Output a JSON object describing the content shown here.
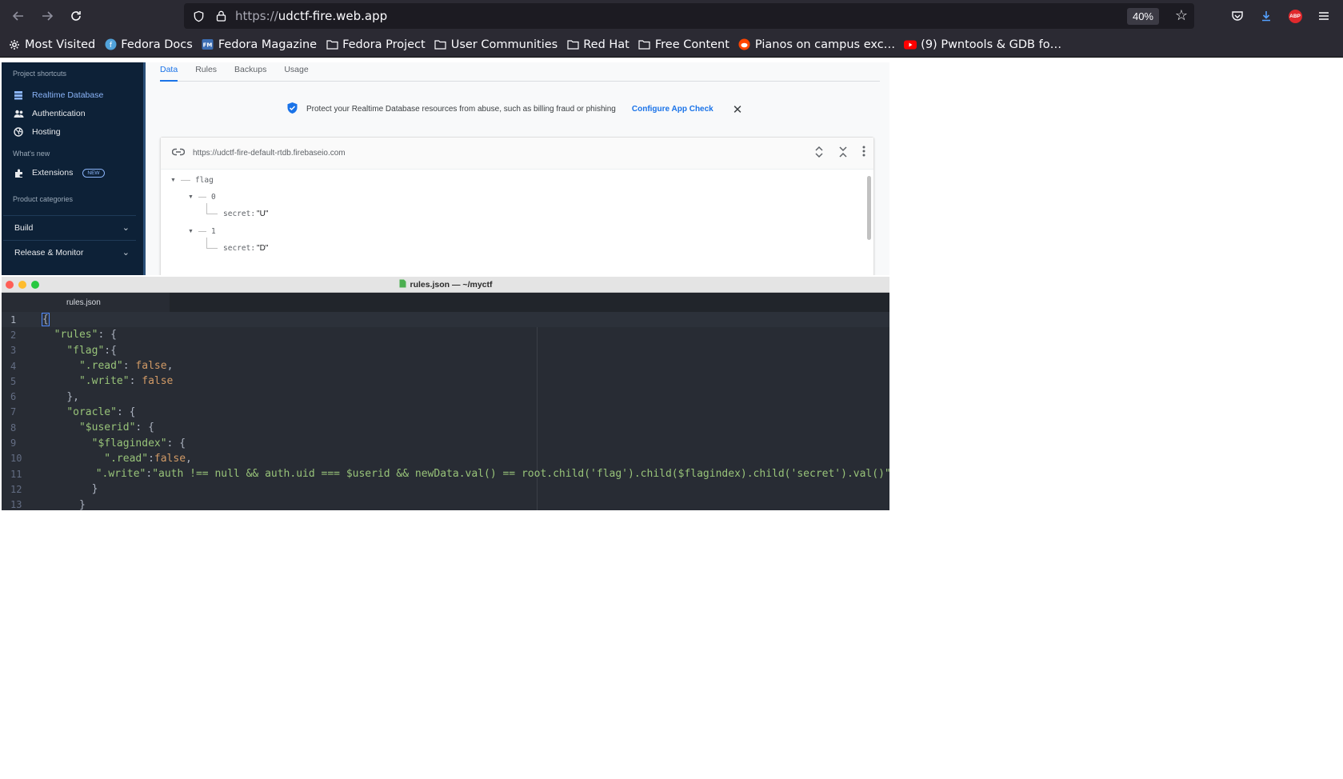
{
  "browser": {
    "url_protocol": "https://",
    "url_host": "udctf-fire.web.app",
    "zoom": "40%",
    "bookmarks": [
      "Most Visited",
      "Fedora Docs",
      "Fedora Magazine",
      "Fedora Project",
      "User Communities",
      "Red Hat",
      "Free Content",
      "Pianos on campus exc…",
      "(9) Pwntools & GDB fo…"
    ],
    "abp_label": "ABP"
  },
  "firebase": {
    "sidebar": {
      "project_shortcuts_label": "Project shortcuts",
      "items": [
        "Realtime Database",
        "Authentication",
        "Hosting"
      ],
      "whats_new_label": "What's new",
      "extensions_label": "Extensions",
      "new_badge": "NEW",
      "product_categories_label": "Product categories",
      "categories": [
        "Build",
        "Release & Monitor"
      ]
    },
    "tabs": [
      "Data",
      "Rules",
      "Backups",
      "Usage"
    ],
    "banner_text": "Protect your Realtime Database resources from abuse, such as billing fraud or phishing",
    "banner_link": "Configure App Check",
    "db_url": "https://udctf-fire-default-rtdb.firebaseio.com",
    "tree": {
      "root_key": "flag",
      "children": [
        {
          "key": "0",
          "field": "secret:",
          "value": "\"U\""
        },
        {
          "key": "1",
          "field": "secret:",
          "value": "\"D\""
        }
      ]
    }
  },
  "editor": {
    "window_title": "rules.json — ~/myctf",
    "tab_label": "rules.json",
    "line_numbers": [
      "1",
      "2",
      "3",
      "4",
      "5",
      "6",
      "7",
      "8",
      "9",
      "10",
      "11",
      "12",
      "13"
    ],
    "code": {
      "l1": "{",
      "l2_key": "\"rules\"",
      "l2_rest": ": {",
      "l3_key": "\"flag\"",
      "l3_rest": ":{",
      "l4_key": "\".read\"",
      "l4_sep": ": ",
      "l4_val": "false",
      "l4_end": ",",
      "l5_key": "\".write\"",
      "l5_sep": ": ",
      "l5_val": "false",
      "l6": "},",
      "l7_key": "\"oracle\"",
      "l7_rest": ": {",
      "l8_key": "\"$userid\"",
      "l8_rest": ": {",
      "l9_key": "\"$flagindex\"",
      "l9_rest": ": {",
      "l10_key": "\".read\"",
      "l10_sep": ":",
      "l10_val": "false",
      "l10_end": ",",
      "l11_key": "\".write\"",
      "l11_sep": ":",
      "l11_val": "\"auth !== null && auth.uid === $userid && newData.val() == root.child('flag').child($flagindex).child('secret').val()\"",
      "l12": "}",
      "l13": "}"
    }
  }
}
